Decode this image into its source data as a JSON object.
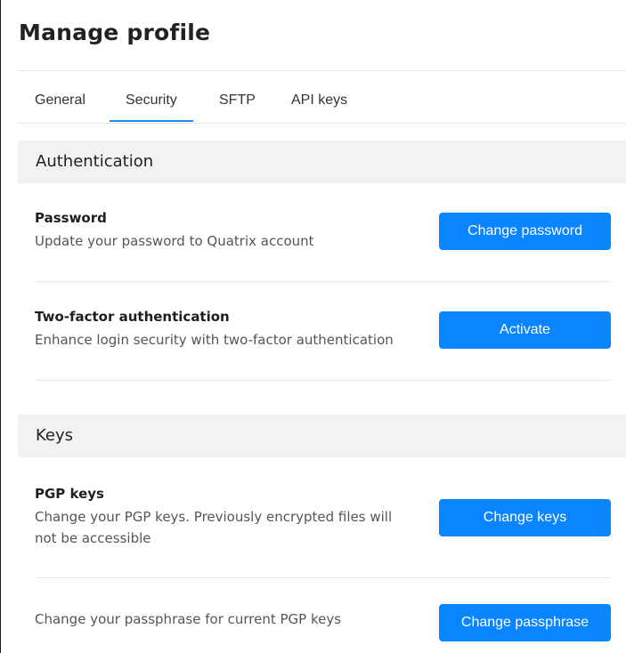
{
  "window": {
    "title": "Manage profile"
  },
  "tabs": [
    {
      "label": "General",
      "active": false
    },
    {
      "label": "Security",
      "active": true
    },
    {
      "label": "SFTP",
      "active": false
    },
    {
      "label": "API keys",
      "active": false
    }
  ],
  "sections": {
    "authentication": {
      "heading": "Authentication",
      "rows": [
        {
          "title": "Password",
          "description": "Update your password to Quatrix account",
          "button": "Change password"
        },
        {
          "title": "Two-factor authentication",
          "description": "Enhance login security with two-factor authentication",
          "button": "Activate"
        }
      ]
    },
    "keys": {
      "heading": "Keys",
      "rows": [
        {
          "title": "PGP keys",
          "description_line1": "Change your PGP keys. Previously encrypted files will",
          "description_line2": "not be accessible",
          "button": "Change keys"
        },
        {
          "description": "Change your passphrase for current PGP keys",
          "button": "Change passphrase"
        }
      ]
    }
  },
  "colors": {
    "accent": "#0b84ff",
    "section_bg": "#f2f2f2",
    "divider": "#e6e6e6"
  }
}
